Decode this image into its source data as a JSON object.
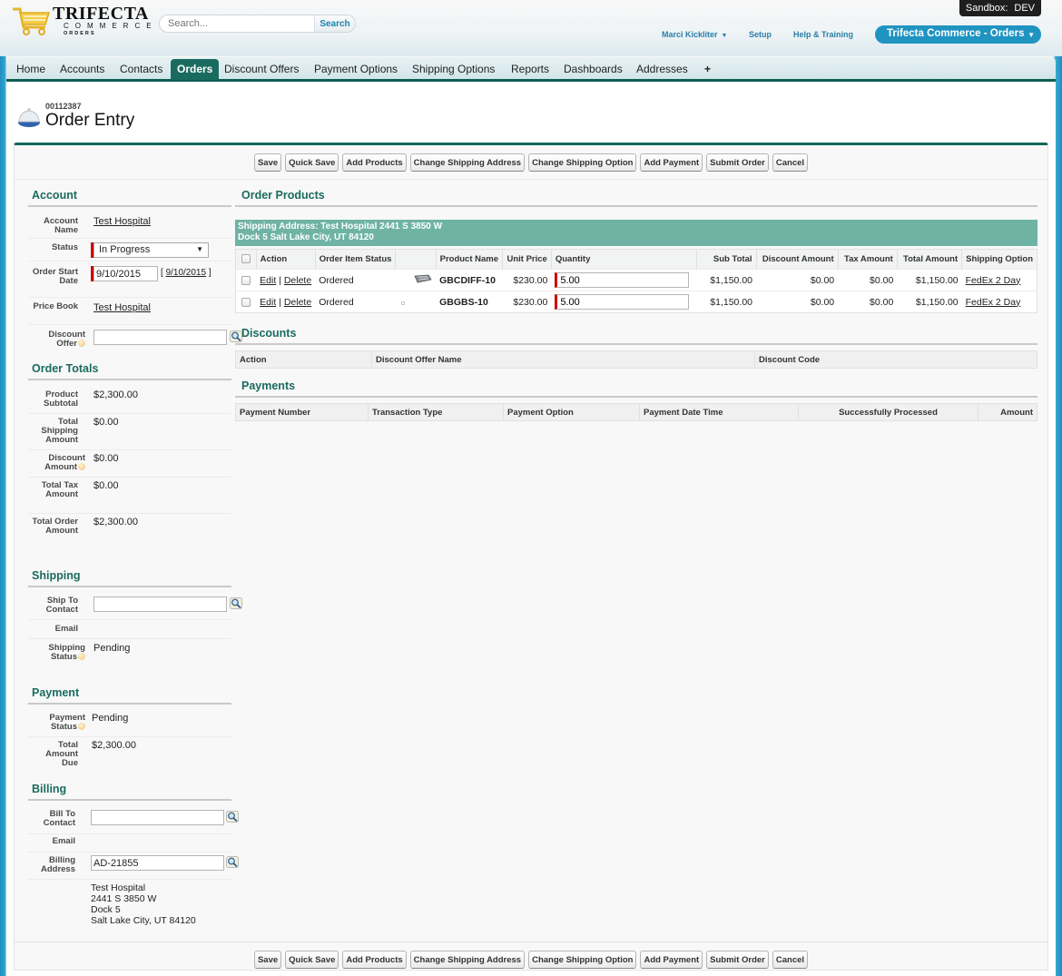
{
  "header": {
    "logo": {
      "title": "TRIFECTA",
      "subtitle": "COMMERCE",
      "tag": "ORDERS"
    },
    "search": {
      "placeholder": "Search...",
      "button_label": "Search"
    },
    "sandbox": {
      "label": "Sandbox:",
      "value": "DEV"
    },
    "user_name": "Marci Kickliter",
    "setup_label": "Setup",
    "help_label": "Help & Training",
    "app_switcher_label": "Trifecta Commerce - Orders"
  },
  "tabs": [
    {
      "label": "Home",
      "active": false
    },
    {
      "label": "Accounts",
      "active": false
    },
    {
      "label": "Contacts",
      "active": false
    },
    {
      "label": "Orders",
      "active": true
    },
    {
      "label": "Discount Offers",
      "active": false
    },
    {
      "label": "Payment Options",
      "active": false
    },
    {
      "label": "Shipping Options",
      "active": false
    },
    {
      "label": "Reports",
      "active": false
    },
    {
      "label": "Dashboards",
      "active": false
    },
    {
      "label": "Addresses",
      "active": false
    },
    {
      "label": "+",
      "active": false
    }
  ],
  "page": {
    "record_number": "00112387",
    "title": "Order Entry"
  },
  "buttons": {
    "save": "Save",
    "quick_save": "Quick Save",
    "add_products": "Add Products",
    "change_shipping_address": "Change Shipping Address",
    "change_shipping_option": "Change Shipping Option",
    "add_payment": "Add Payment",
    "submit_order": "Submit Order",
    "cancel": "Cancel"
  },
  "account": {
    "heading": "Account",
    "account_name_label": "Account Name",
    "account_name": "Test Hospital",
    "status_label": "Status",
    "status": "In Progress",
    "start_date_label": "Order Start Date",
    "start_date": "9/10/2015",
    "start_date_today": "9/10/2015",
    "price_book_label": "Price Book",
    "price_book": "Test Hospital",
    "discount_offer_label": "Discount Offer",
    "discount_offer": ""
  },
  "order_totals": {
    "heading": "Order Totals",
    "rows": [
      {
        "label": "Product Subtotal",
        "value": "$2,300.00"
      },
      {
        "label": "Total Shipping Amount",
        "value": "$0.00"
      },
      {
        "label": "Discount Amount",
        "value": "$0.00"
      },
      {
        "label": "Total Tax Amount",
        "value": "$0.00"
      },
      {
        "label": "Total Order Amount",
        "value": "$2,300.00"
      }
    ]
  },
  "shipping": {
    "heading": "Shipping",
    "ship_to_label": "Ship To Contact",
    "ship_to": "",
    "email_label": "Email",
    "status_label": "Shipping Status",
    "status": "Pending"
  },
  "payment": {
    "heading": "Payment",
    "status_label": "Payment Status",
    "status": "Pending",
    "due_label": "Total Amount Due",
    "due": "$2,300.00"
  },
  "billing": {
    "heading": "Billing",
    "bill_to_label": "Bill To Contact",
    "bill_to": "",
    "email_label": "Email",
    "address_label": "Billing Address",
    "address_id": "AD-21855",
    "address_lines": [
      "Test Hospital",
      "2441 S 3850 W",
      "Dock 5",
      "Salt Lake City, UT 84120"
    ]
  },
  "order_products": {
    "heading": "Order Products",
    "shipping_address_line1": "Shipping Address: Test Hospital 2441 S 3850 W",
    "shipping_address_line2": "Dock 5 Salt Lake City, UT 84120",
    "columns": [
      "Action",
      "Order Item Status",
      "",
      "Product Name",
      "Unit Price",
      "Quantity",
      "Sub Total",
      "Discount Amount",
      "Tax Amount",
      "Total Amount",
      "Shipping Option"
    ],
    "rows": [
      {
        "edit": "Edit",
        "delete": "Delete",
        "status": "Ordered",
        "product": "GBCDIFF-10",
        "unit_price": "$230.00",
        "quantity": "5.00",
        "sub_total": "$1,150.00",
        "discount": "$0.00",
        "tax": "$0.00",
        "total": "$1,150.00",
        "shipping_option": "FedEx 2 Day"
      },
      {
        "edit": "Edit",
        "delete": "Delete",
        "status": "Ordered",
        "product": "GBGBS-10",
        "unit_price": "$230.00",
        "quantity": "5.00",
        "sub_total": "$1,150.00",
        "discount": "$0.00",
        "tax": "$0.00",
        "total": "$1,150.00",
        "shipping_option": "FedEx 2 Day"
      }
    ]
  },
  "discounts": {
    "heading": "Discounts",
    "columns": [
      "Action",
      "Discount Offer Name",
      "Discount Code"
    ]
  },
  "payments": {
    "heading": "Payments",
    "columns": [
      "Payment Number",
      "Transaction Type",
      "Payment Option",
      "Payment Date Time",
      "Successfully Processed",
      "Amount"
    ]
  }
}
